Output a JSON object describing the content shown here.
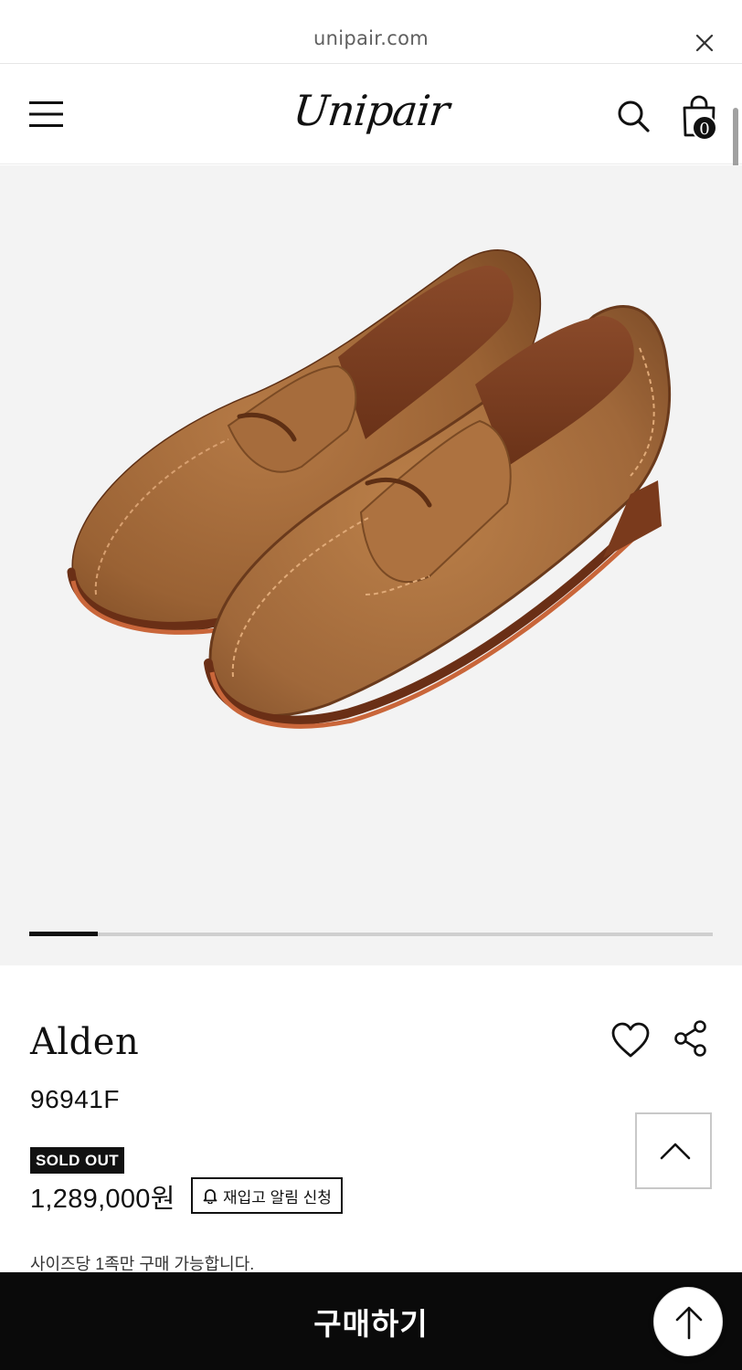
{
  "browser": {
    "url": "unipair.com",
    "close_icon": "close-icon"
  },
  "header": {
    "logo": "Unipair",
    "menu_icon": "hamburger-menu-icon",
    "search_icon": "search-icon",
    "cart_icon": "shopping-bag-icon",
    "cart_count": "0"
  },
  "gallery": {
    "image": "brown suede penny loafers",
    "slide_progress": 0.1
  },
  "product": {
    "brand": "Alden",
    "model": "96941F",
    "badge": "SOLD OUT",
    "price": "1,289,000원",
    "restock_label": "재입고 알림 신청",
    "note": "사이즈당 1족만 구매 가능합니다.",
    "wishlist_icon": "heart-icon",
    "share_icon": "share-icon"
  },
  "buybar": {
    "label": "구매하기"
  },
  "colors": {
    "accent": "#111111",
    "gallery_bg": "#f3f3f3",
    "suede": "#a86a3a"
  }
}
